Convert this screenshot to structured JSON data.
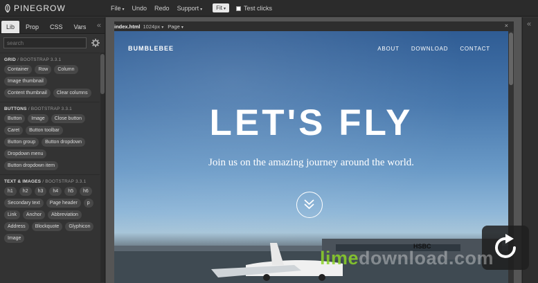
{
  "app": {
    "name": "PINEGROW"
  },
  "menu": {
    "items": [
      {
        "label": "File",
        "caret": "▾"
      },
      {
        "label": "Undo"
      },
      {
        "label": "Redo"
      },
      {
        "label": "Support",
        "caret": "▾"
      }
    ],
    "fit_label": "Fit",
    "fit_caret": "▾",
    "test_clicks_label": "Test clicks"
  },
  "left_panel": {
    "tabs": [
      "Lib",
      "Prop",
      "CSS",
      "Vars"
    ],
    "active_tab": "Lib",
    "collapse_glyph": "«",
    "search_placeholder": "search",
    "sections": [
      {
        "title": "GRID",
        "sub": "/ BOOTSTRAP 3.3.1",
        "items": [
          "Container",
          "Row",
          "Column",
          "Image thumbnail",
          "Content thumbnail",
          "Clear columns"
        ]
      },
      {
        "title": "BUTTONS",
        "sub": "/ BOOTSTRAP 3.3.1",
        "items": [
          "Button",
          "Image",
          "Close button",
          "Caret",
          "Button toolbar",
          "Button group",
          "Button dropdown",
          "Dropdown menu",
          "Button dropdown item"
        ]
      },
      {
        "title": "TEXT & IMAGES",
        "sub": "/ BOOTSTRAP 3.3.1",
        "items": [
          "h1",
          "h2",
          "h3",
          "h4",
          "h5",
          "h6",
          "Secondary text",
          "Page header",
          "p",
          "Link",
          "Anchor",
          "Abbreviation",
          "Address",
          "Blockquote",
          "Glyphicon",
          "Image"
        ]
      }
    ]
  },
  "document": {
    "filename": "index.html",
    "size": "1024px",
    "size_caret": "▾",
    "page_label": "Page",
    "page_caret": "▾",
    "close_glyph": "×"
  },
  "site": {
    "brand": "BUMBLEBEE",
    "nav": [
      "ABOUT",
      "DOWNLOAD",
      "CONTACT"
    ],
    "hero_title": "LET'S FLY",
    "hero_subtitle": "Join us on the amazing journey around the world.",
    "airport_sign": "HSBC"
  },
  "right_panel": {
    "collapse_glyph": "«"
  },
  "watermark": {
    "part1": "lime",
    "part2": "download.com"
  },
  "colors": {
    "sky_top": "#2f5c94",
    "sky_bottom": "#a7c5d9",
    "watermark": "#8cd228"
  }
}
